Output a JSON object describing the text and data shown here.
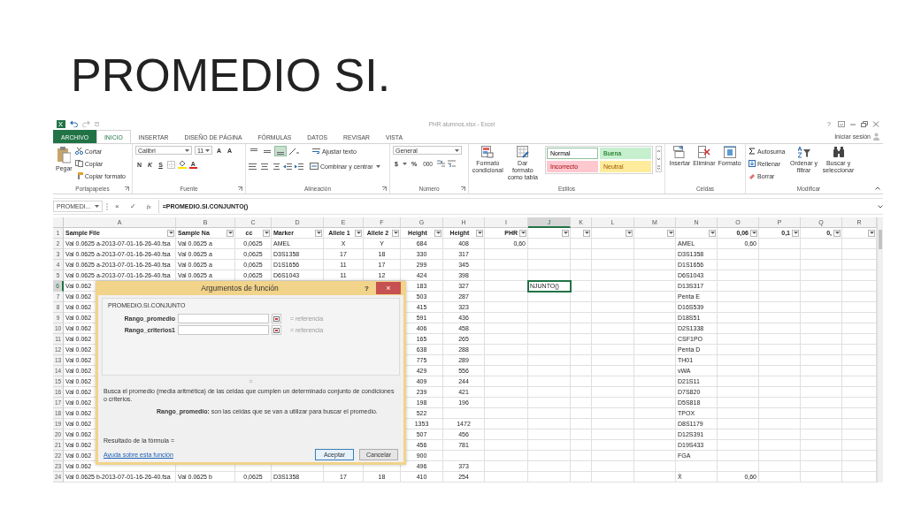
{
  "slide": {
    "title": "PROMEDIO SI."
  },
  "window": {
    "title": "PHR alumnos.xlsx - Excel",
    "help": "?"
  },
  "tabs": [
    {
      "label": "ARCHIVO",
      "kind": "file",
      "selected": false
    },
    {
      "label": "INICIO",
      "kind": "tab",
      "selected": true
    },
    {
      "label": "INSERTAR",
      "kind": "tab",
      "selected": false
    },
    {
      "label": "DISEÑO DE PÁGINA",
      "kind": "tab",
      "selected": false
    },
    {
      "label": "FÓRMULAS",
      "kind": "tab",
      "selected": false
    },
    {
      "label": "DATOS",
      "kind": "tab",
      "selected": false
    },
    {
      "label": "REVISAR",
      "kind": "tab",
      "selected": false
    },
    {
      "label": "VISTA",
      "kind": "tab",
      "selected": false
    }
  ],
  "account": {
    "label": "Iniciar sesión"
  },
  "ribbon": {
    "clipboard": {
      "label": "Portapapeles",
      "paste": "Pegar",
      "items": [
        {
          "label": "Cortar"
        },
        {
          "label": "Copiar"
        },
        {
          "label": "Copiar formato"
        }
      ]
    },
    "font": {
      "label": "Fuente",
      "family": "Calibri",
      "size": "11",
      "grow": "A",
      "shrink": "A",
      "bold": "N",
      "italic": "K",
      "underline": "S",
      "color_letter": "A"
    },
    "alignment": {
      "label": "Alineación",
      "wrap": "Ajustar texto",
      "merge": "Combinar y centrar",
      "vertical": [
        {
          "selected": false
        },
        {
          "selected": false
        },
        {
          "selected": true
        }
      ]
    },
    "number": {
      "label": "Número",
      "format": "General",
      "currency": "$",
      "percent": "%",
      "thousands": "000"
    },
    "styles": {
      "label": "Estilos",
      "buttons": [
        {
          "label": "Formato condicional"
        },
        {
          "label": "Dar formato como tabla"
        }
      ],
      "cell_styles": [
        {
          "label": "Normal",
          "kind": "normal",
          "color": "#ffffff",
          "selected": true
        },
        {
          "label": "Buena",
          "kind": "good",
          "color": "#c6efce",
          "selected": false
        },
        {
          "label": "Incorrecto",
          "kind": "bad",
          "color": "#ffc7ce",
          "selected": false
        },
        {
          "label": "Neutral",
          "kind": "neutral",
          "color": "#ffeb9c",
          "selected": false
        }
      ]
    },
    "cells": {
      "label": "Celdas",
      "buttons": [
        {
          "label": "Insertar"
        },
        {
          "label": "Eliminar"
        },
        {
          "label": "Formato"
        }
      ]
    },
    "editing": {
      "label": "Modificar",
      "items": [
        {
          "label": "Autosuma"
        },
        {
          "label": "Rellenar"
        },
        {
          "label": "Borrar"
        }
      ],
      "buttons": [
        {
          "label": "Ordenar y filtrar"
        },
        {
          "label": "Buscar y seleccionar"
        }
      ]
    }
  },
  "formula_bar": {
    "name_box": "PROMEDI...",
    "cancel": "×",
    "enter": "✓",
    "fx": "fx",
    "formula": "=PROMEDIO.SI.CONJUNTO()"
  },
  "sheet": {
    "columns": [
      {
        "letter": "A",
        "selected": false
      },
      {
        "letter": "B",
        "selected": false
      },
      {
        "letter": "C",
        "selected": false
      },
      {
        "letter": "D",
        "selected": false
      },
      {
        "letter": "E",
        "selected": false
      },
      {
        "letter": "F",
        "selected": false
      },
      {
        "letter": "G",
        "selected": false
      },
      {
        "letter": "H",
        "selected": false
      },
      {
        "letter": "I",
        "selected": false
      },
      {
        "letter": "J",
        "selected": true
      },
      {
        "letter": "K",
        "selected": false
      },
      {
        "letter": "L",
        "selected": false
      },
      {
        "letter": "M",
        "selected": false
      },
      {
        "letter": "N",
        "selected": false
      },
      {
        "letter": "O",
        "selected": false
      },
      {
        "letter": "P",
        "selected": false
      },
      {
        "letter": "Q",
        "selected": false
      },
      {
        "letter": "R",
        "selected": false
      }
    ],
    "rows": [
      {
        "number": "1",
        "kind": "header",
        "selected": false,
        "cells": [
          "Sample File",
          "Sample Na",
          "cc",
          "Marker",
          "Allele 1",
          "Allele 2",
          "Height",
          "Height",
          "PHR",
          null,
          null,
          null,
          null,
          null,
          "0,06",
          "0,1",
          "0,"
        ]
      },
      {
        "number": "2",
        "kind": "data",
        "selected": false,
        "cells": [
          "Val 0.0625 a-2013-07-01-16-26-40.fsa",
          "Val 0.0625 a",
          "0,0625",
          "AMEL",
          "X",
          "Y",
          "684",
          "408",
          "0,60",
          null,
          null,
          null,
          null,
          "AMEL",
          "0,60"
        ]
      },
      {
        "number": "3",
        "kind": "data",
        "selected": false,
        "cells": [
          "Val 0.0625 a-2013-07-01-16-26-40.fsa",
          "Val 0.0625 a",
          "0,0625",
          "D3S1358",
          "17",
          "18",
          "330",
          "317",
          null,
          null,
          null,
          null,
          null,
          "D3S1358"
        ]
      },
      {
        "number": "4",
        "kind": "data",
        "selected": false,
        "cells": [
          "Val 0.0625 a-2013-07-01-16-26-40.fsa",
          "Val 0.0625 a",
          "0,0625",
          "D1S1656",
          "11",
          "17",
          "299",
          "345",
          null,
          null,
          null,
          null,
          null,
          "D1S1656"
        ]
      },
      {
        "number": "5",
        "kind": "data",
        "selected": false,
        "cells": [
          "Val 0.0625 a-2013-07-01-16-26-40.fsa",
          "Val 0.0625 a",
          "0,0625",
          "D6S1043",
          "11",
          "12",
          "424",
          "398",
          null,
          null,
          null,
          null,
          null,
          "D6S1043"
        ]
      },
      {
        "number": "6",
        "kind": "data",
        "selected": true,
        "cells": [
          "Val 0.062",
          null,
          null,
          null,
          null,
          null,
          "183",
          "327",
          null,
          "NJUNTO()",
          null,
          null,
          null,
          "D13S317"
        ]
      },
      {
        "number": "7",
        "kind": "data",
        "selected": false,
        "cells": [
          "Val 0.062",
          null,
          null,
          null,
          null,
          null,
          "503",
          "287",
          null,
          null,
          null,
          null,
          null,
          "Penta E"
        ]
      },
      {
        "number": "8",
        "kind": "data",
        "selected": false,
        "cells": [
          "Val 0.062",
          null,
          null,
          null,
          null,
          null,
          "415",
          "323",
          null,
          null,
          null,
          null,
          null,
          "D16S539"
        ]
      },
      {
        "number": "9",
        "kind": "data",
        "selected": false,
        "cells": [
          "Val 0.062",
          null,
          null,
          null,
          null,
          null,
          "591",
          "436",
          null,
          null,
          null,
          null,
          null,
          "D18S51"
        ]
      },
      {
        "number": "10",
        "kind": "data",
        "selected": false,
        "cells": [
          "Val 0.062",
          null,
          null,
          null,
          null,
          null,
          "406",
          "458",
          null,
          null,
          null,
          null,
          null,
          "D2S1338"
        ]
      },
      {
        "number": "11",
        "kind": "data",
        "selected": false,
        "cells": [
          "Val 0.062",
          null,
          null,
          null,
          null,
          null,
          "165",
          "265",
          null,
          null,
          null,
          null,
          null,
          "CSF1PO"
        ]
      },
      {
        "number": "12",
        "kind": "data",
        "selected": false,
        "cells": [
          "Val 0.062",
          null,
          null,
          null,
          null,
          null,
          "638",
          "288",
          null,
          null,
          null,
          null,
          null,
          "Penta D"
        ]
      },
      {
        "number": "13",
        "kind": "data",
        "selected": false,
        "cells": [
          "Val 0.062",
          null,
          null,
          null,
          null,
          null,
          "775",
          "289",
          null,
          null,
          null,
          null,
          null,
          "TH01"
        ]
      },
      {
        "number": "14",
        "kind": "data",
        "selected": false,
        "cells": [
          "Val 0.062",
          null,
          null,
          null,
          null,
          null,
          "429",
          "556",
          null,
          null,
          null,
          null,
          null,
          "vWA"
        ]
      },
      {
        "number": "15",
        "kind": "data",
        "selected": false,
        "cells": [
          "Val 0.062",
          null,
          null,
          null,
          null,
          null,
          "409",
          "244",
          null,
          null,
          null,
          null,
          null,
          "D21S11"
        ]
      },
      {
        "number": "16",
        "kind": "data",
        "selected": false,
        "cells": [
          "Val 0.062",
          null,
          null,
          null,
          null,
          null,
          "239",
          "421",
          null,
          null,
          null,
          null,
          null,
          "D7S820"
        ]
      },
      {
        "number": "17",
        "kind": "data",
        "selected": false,
        "cells": [
          "Val 0.062",
          null,
          null,
          null,
          null,
          null,
          "198",
          "196",
          null,
          null,
          null,
          null,
          null,
          "D5S818"
        ]
      },
      {
        "number": "18",
        "kind": "data",
        "selected": false,
        "cells": [
          "Val 0.062",
          null,
          null,
          null,
          null,
          null,
          "522",
          null,
          null,
          null,
          null,
          null,
          null,
          "TPOX"
        ]
      },
      {
        "number": "19",
        "kind": "data",
        "selected": false,
        "cells": [
          "Val 0.062",
          null,
          null,
          null,
          null,
          null,
          "1353",
          "1472",
          null,
          null,
          null,
          null,
          null,
          "D8S1179"
        ]
      },
      {
        "number": "20",
        "kind": "data",
        "selected": false,
        "cells": [
          "Val 0.062",
          null,
          null,
          null,
          null,
          null,
          "507",
          "456",
          null,
          null,
          null,
          null,
          null,
          "D12S391"
        ]
      },
      {
        "number": "21",
        "kind": "data",
        "selected": false,
        "cells": [
          "Val 0.062",
          null,
          null,
          null,
          null,
          null,
          "456",
          "781",
          null,
          null,
          null,
          null,
          null,
          "D19S433"
        ]
      },
      {
        "number": "22",
        "kind": "data",
        "selected": false,
        "cells": [
          "Val 0.062",
          null,
          null,
          null,
          null,
          null,
          "900",
          null,
          null,
          null,
          null,
          null,
          null,
          "FGA"
        ]
      },
      {
        "number": "23",
        "kind": "data",
        "selected": false,
        "cells": [
          "Val 0.062",
          null,
          null,
          null,
          null,
          null,
          "496",
          "373"
        ]
      },
      {
        "number": "24",
        "kind": "data",
        "selected": false,
        "cells": [
          "Val 0.0625 b-2013-07-01-16-26-40.fsa",
          "Val 0.0625 b",
          "0,0625",
          "D3S1358",
          "17",
          "18",
          "410",
          "254",
          null,
          null,
          null,
          null,
          null,
          "X̄",
          "0,60"
        ]
      }
    ]
  },
  "dialog": {
    "title": "Argumentos de función",
    "help": "?",
    "close": "×",
    "function": "PROMEDIO.SI.CONJUNTO",
    "arguments": [
      {
        "label": "Rango_promedio",
        "hint": "= referencia"
      },
      {
        "label": "Rango_criterios1",
        "hint": "= referencia"
      }
    ],
    "equals": "=",
    "description": "Busca el promedio (media aritmética) de las celdas que cumplen un determinado conjunto de condiciones o criterios.",
    "argument_help": "**Rango_promedio:**  son las celdas que se van a utilizar para buscar el promedio.",
    "result": "Resultado de la fórmula =",
    "help_link": "Ayuda sobre esta función",
    "buttons": [
      {
        "label": "Aceptar",
        "kind": "primary"
      },
      {
        "label": "Cancelar",
        "kind": "normal"
      }
    ]
  }
}
